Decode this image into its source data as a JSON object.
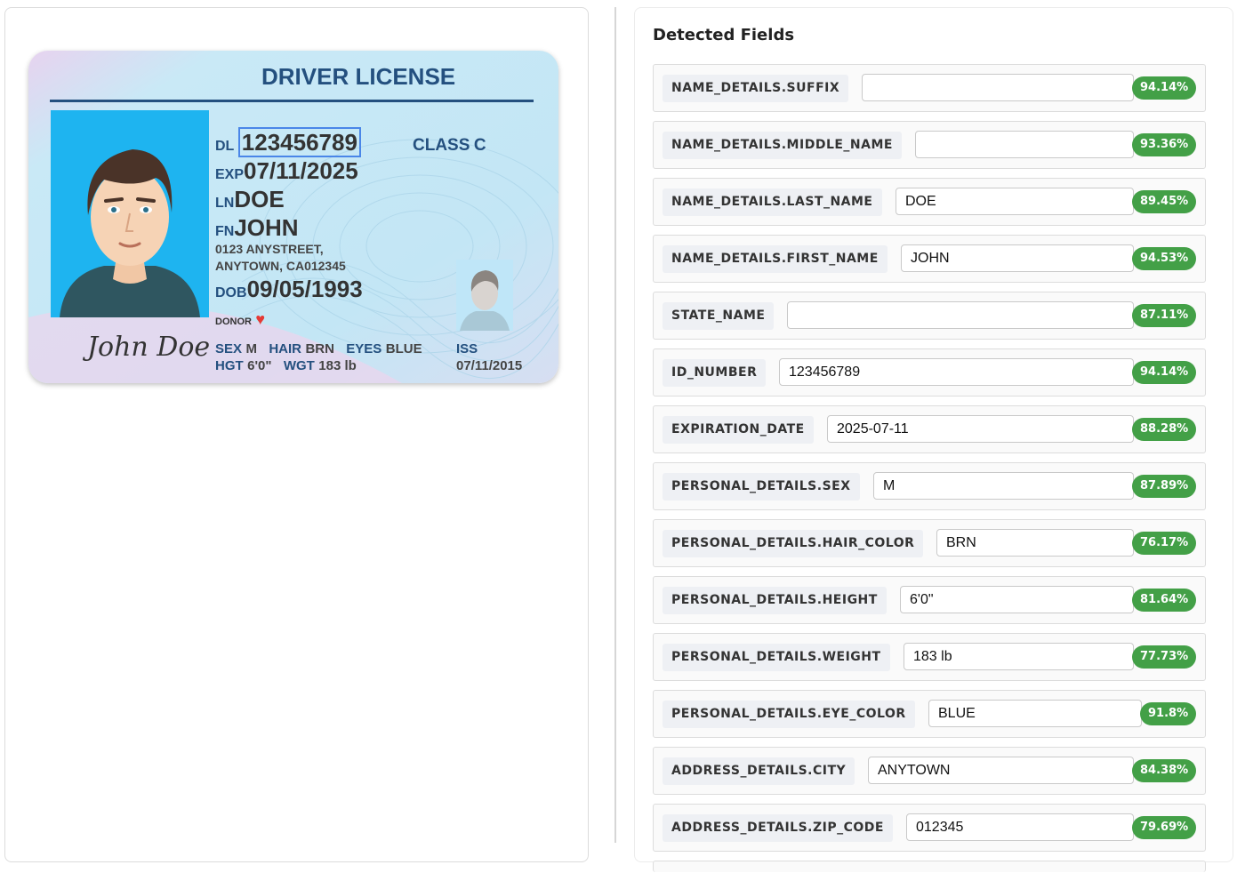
{
  "card": {
    "title": "DRIVER LICENSE",
    "dl_prefix": "DL",
    "dl_number": "123456789",
    "class_prefix": "CLASS",
    "class_value": "C",
    "exp_prefix": "EXP",
    "exp": "07/11/2025",
    "ln_prefix": "LN",
    "last_name": "DOE",
    "fn_prefix": "FN",
    "first_name": "JOHN",
    "address_line1": "0123 ANYSTREET,",
    "address_line2": "ANYTOWN, CA012345",
    "dob_prefix": "DOB",
    "dob": "09/05/1993",
    "donor_label": "DONOR",
    "heart_glyph": "♥",
    "signature": "John Doe",
    "sex_prefix": "SEX",
    "sex": "M",
    "hair_prefix": "HAIR",
    "hair": "BRN",
    "eyes_prefix": "EYES",
    "eyes": "BLUE",
    "hgt_prefix": "HGT",
    "hgt": "6'0\"",
    "wgt_prefix": "WGT",
    "wgt": "183 lb",
    "iss_prefix": "ISS",
    "iss": "07/11/2015",
    "colors": {
      "title": "#24507f",
      "photo_bg": "#1eb4f0",
      "heart": "#e53935"
    }
  },
  "detected": {
    "title": "Detected Fields",
    "fields": [
      {
        "label": "NAME_DETAILS.SUFFIX",
        "value": "",
        "confidence": "94.14%"
      },
      {
        "label": "NAME_DETAILS.MIDDLE_NAME",
        "value": "",
        "confidence": "93.36%"
      },
      {
        "label": "NAME_DETAILS.LAST_NAME",
        "value": "DOE",
        "confidence": "89.45%"
      },
      {
        "label": "NAME_DETAILS.FIRST_NAME",
        "value": "JOHN",
        "confidence": "94.53%"
      },
      {
        "label": "STATE_NAME",
        "value": "",
        "confidence": "87.11%"
      },
      {
        "label": "ID_NUMBER",
        "value": "123456789",
        "confidence": "94.14%"
      },
      {
        "label": "EXPIRATION_DATE",
        "value": "2025-07-11",
        "confidence": "88.28%"
      },
      {
        "label": "PERSONAL_DETAILS.SEX",
        "value": "M",
        "confidence": "87.89%"
      },
      {
        "label": "PERSONAL_DETAILS.HAIR_COLOR",
        "value": "BRN",
        "confidence": "76.17%"
      },
      {
        "label": "PERSONAL_DETAILS.HEIGHT",
        "value": "6'0\"",
        "confidence": "81.64%"
      },
      {
        "label": "PERSONAL_DETAILS.WEIGHT",
        "value": "183 lb",
        "confidence": "77.73%"
      },
      {
        "label": "PERSONAL_DETAILS.EYE_COLOR",
        "value": "BLUE",
        "confidence": "91.8%"
      },
      {
        "label": "ADDRESS_DETAILS.CITY",
        "value": "ANYTOWN",
        "confidence": "84.38%"
      },
      {
        "label": "ADDRESS_DETAILS.ZIP_CODE",
        "value": "012345",
        "confidence": "79.69%"
      }
    ],
    "confidence_color": "#43a047"
  }
}
